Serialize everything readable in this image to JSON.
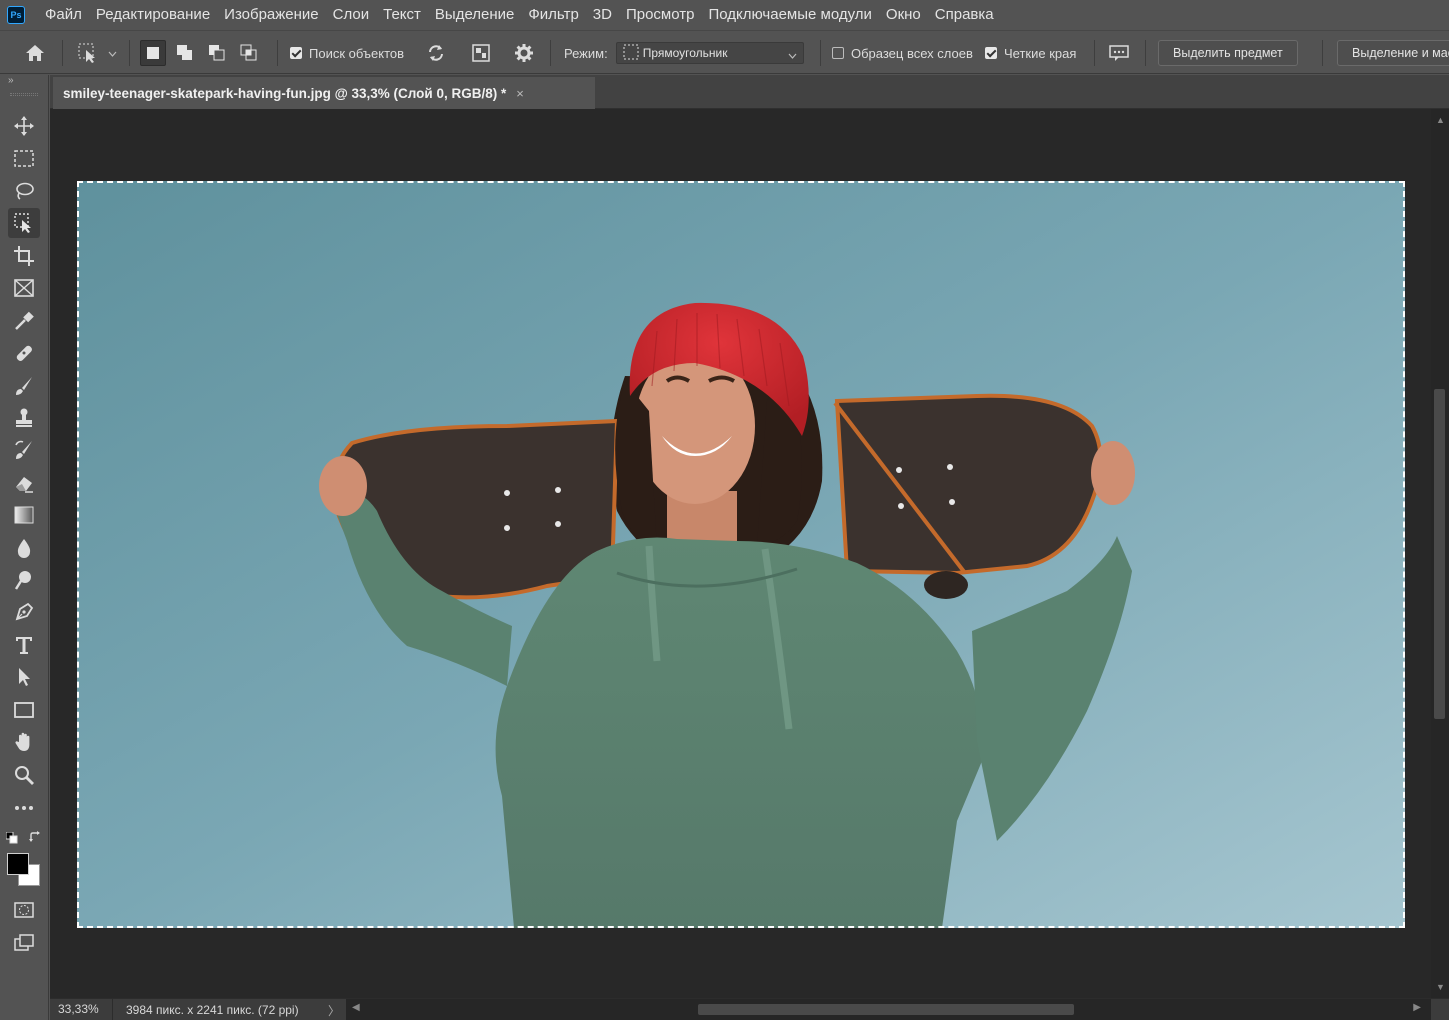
{
  "app": {
    "logo": "Ps"
  },
  "menu": [
    "Файл",
    "Редактирование",
    "Изображение",
    "Слои",
    "Текст",
    "Выделение",
    "Фильтр",
    "3D",
    "Просмотр",
    "Подключаемые модули",
    "Окно",
    "Справка"
  ],
  "options": {
    "object_finder_label": "Поиск объектов",
    "object_finder_checked": true,
    "mode_label": "Режим:",
    "mode_value": "Прямоугольник",
    "sample_all_layers_label": "Образец всех слоев",
    "sample_all_layers_checked": false,
    "hard_edge_label": "Четкие края",
    "hard_edge_checked": true,
    "select_subject_button": "Выделить предмет",
    "select_mask_button": "Выделение и маска..."
  },
  "document": {
    "tab_title": "smiley-teenager-skatepark-having-fun.jpg @ 33,3% (Слой 0, RGB/8) *",
    "close_glyph": "×"
  },
  "status": {
    "zoom": "33,33%",
    "doc_info": "3984 пикс. x 2241 пикс. (72 ppi)",
    "arrow": "〉"
  },
  "colors": {
    "foreground": "#000000",
    "background": "#ffffff",
    "ui_panel": "#535353",
    "canvas_bg": "#282828"
  },
  "toolbar": {
    "tools": [
      "move-tool",
      "rectangular-marquee-tool",
      "lasso-tool",
      "object-selection-tool",
      "crop-tool",
      "frame-tool",
      "eyedropper-tool",
      "spot-healing-tool",
      "brush-tool",
      "clone-stamp-tool",
      "history-brush-tool",
      "eraser-tool",
      "gradient-tool",
      "blur-tool",
      "dodge-tool",
      "pen-tool",
      "type-tool",
      "path-selection-tool",
      "rectangle-tool",
      "hand-tool",
      "zoom-tool",
      "more-tools"
    ],
    "active_tool": "object-selection-tool"
  }
}
